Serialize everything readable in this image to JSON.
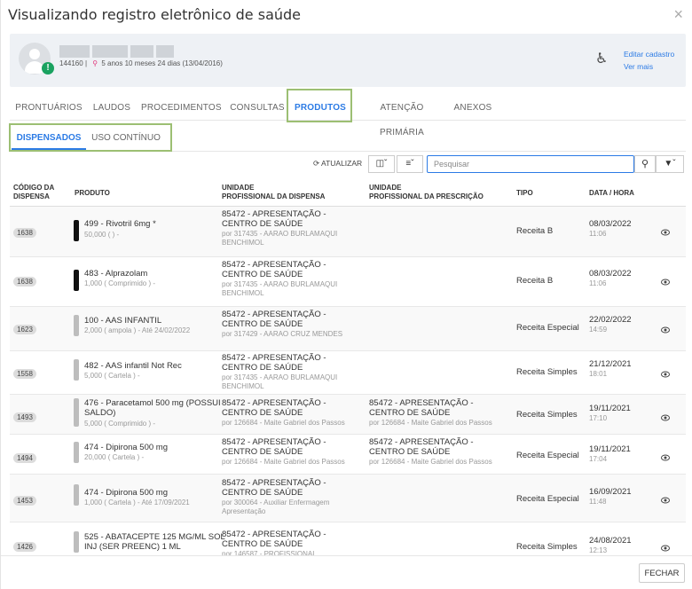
{
  "modal": {
    "title": "Visualizando registro eletrônico de saúde",
    "close_label": "×"
  },
  "patient": {
    "record_number": "144160",
    "separator": "|",
    "age": "5 anos 10 meses 24 dias (13/04/2016)",
    "warning_badge": "!",
    "links": {
      "edit": "Editar cadastro",
      "more": "Ver mais"
    }
  },
  "tabs": [
    {
      "label": "PRONTUÁRIOS"
    },
    {
      "label": "LAUDOS"
    },
    {
      "label": "PROCEDIMENTOS"
    },
    {
      "label": "CONSULTAS"
    },
    {
      "label": "PRODUTOS",
      "active": true
    },
    {
      "label": "ATENÇÃO PRIMÁRIA"
    },
    {
      "label": "ANEXOS"
    }
  ],
  "subtabs": [
    {
      "label": "DISPENSADOS",
      "active": true
    },
    {
      "label": "USO CONTÍNUO"
    }
  ],
  "toolbar": {
    "refresh_label": "ATUALIZAR",
    "search_placeholder": "Pesquisar",
    "columns_icon": "columns-icon",
    "list_icon": "list-icon",
    "search_icon": "search-icon",
    "filter_icon": "filter-icon"
  },
  "table": {
    "headers": {
      "code": [
        "CÓDIGO DA",
        "DISPENSA"
      ],
      "product": "PRODUTO",
      "unit_dispense": [
        "UNIDADE",
        "PROFISSIONAL DA DISPENSA"
      ],
      "unit_prescription": [
        "UNIDADE",
        "PROFISSIONAL DA PRESCRIÇÃO"
      ],
      "type": "TIPO",
      "datetime": "DATA / HORA"
    },
    "rows": [
      {
        "code": "1638",
        "bar_color": "#111111",
        "product": "499 - Rivotril 6mg *",
        "product_detail": "50,000 ( ) -",
        "dispense_unit": "85472 - APRESENTAÇÃO - CENTRO DE SAÚDE",
        "dispense_prof": "por 317435 - AARAO BURLAMAQUI BENCHIMOL",
        "presc_unit": "",
        "presc_prof": "",
        "type": "Receita B",
        "date": "08/03/2022",
        "time": "11:06"
      },
      {
        "code": "1638",
        "bar_color": "#111111",
        "product": "483 - Alprazolam",
        "product_detail": "1,000 ( Comprimido ) -",
        "dispense_unit": "85472 - APRESENTAÇÃO - CENTRO DE SAÚDE",
        "dispense_prof": "por 317435 - AARAO BURLAMAQUI BENCHIMOL",
        "presc_unit": "",
        "presc_prof": "",
        "type": "Receita B",
        "date": "08/03/2022",
        "time": "11:06"
      },
      {
        "code": "1623",
        "bar_color": "#bdbdbd",
        "product": "100 - AAS INFANTIL",
        "product_detail": "2,000 ( ampola ) - Até 24/02/2022",
        "dispense_unit": "85472 - APRESENTAÇÃO - CENTRO DE SAÚDE",
        "dispense_prof": "por 317429 - AARAO CRUZ MENDES",
        "presc_unit": "",
        "presc_prof": "",
        "type": "Receita Especial",
        "date": "22/02/2022",
        "time": "14:59"
      },
      {
        "code": "1558",
        "bar_color": "#bdbdbd",
        "product": "482 - AAS infantil Not Rec",
        "product_detail": "5,000 ( Cartela ) -",
        "dispense_unit": "85472 - APRESENTAÇÃO - CENTRO DE SAÚDE",
        "dispense_prof": "por 317435 - AARAO BURLAMAQUI BENCHIMOL",
        "presc_unit": "",
        "presc_prof": "",
        "type": "Receita Simples",
        "date": "21/12/2021",
        "time": "18:01"
      },
      {
        "code": "1493",
        "bar_color": "#bdbdbd",
        "product": "476 - Paracetamol 500 mg (POSSUI SALDO)",
        "product_detail": "5,000 ( Comprimido ) -",
        "dispense_unit": "85472 - APRESENTAÇÃO - CENTRO DE SAÚDE",
        "dispense_prof": "por 126684 - Maite Gabriel dos Passos",
        "presc_unit": "85472 - APRESENTAÇÃO - CENTRO DE SAÚDE",
        "presc_prof": "por 126684 - Maite Gabriel dos Passos",
        "type": "Receita Simples",
        "date": "19/11/2021",
        "time": "17:10"
      },
      {
        "code": "1494",
        "bar_color": "#bdbdbd",
        "product": "474 - Dipirona 500 mg",
        "product_detail": "20,000 ( Cartela ) -",
        "dispense_unit": "85472 - APRESENTAÇÃO - CENTRO DE SAÚDE",
        "dispense_prof": "por 126684 - Maite Gabriel dos Passos",
        "presc_unit": "85472 - APRESENTAÇÃO - CENTRO DE SAÚDE",
        "presc_prof": "por 126684 - Maite Gabriel dos Passos",
        "type": "Receita Especial",
        "date": "19/11/2021",
        "time": "17:04"
      },
      {
        "code": "1453",
        "bar_color": "#bdbdbd",
        "product": "474 - Dipirona 500 mg",
        "product_detail": "1,000 ( Cartela ) - Até 17/09/2021",
        "dispense_unit": "85472 - APRESENTAÇÃO - CENTRO DE SAÚDE",
        "dispense_prof": "por 300064 - Auxiliar Enfermagem Apresentação",
        "presc_unit": "",
        "presc_prof": "",
        "type": "Receita Especial",
        "date": "16/09/2021",
        "time": "11:48"
      },
      {
        "code": "1426",
        "bar_color": "#bdbdbd",
        "product": "525 - ABATACEPTE 125 MG/ML SOL INJ (SER PREENC) 1 ML",
        "product_detail": "",
        "dispense_unit": "85472 - APRESENTAÇÃO - CENTRO DE SAÚDE",
        "dispense_prof": "por 146587 - PROFISSIONAL",
        "presc_unit": "",
        "presc_prof": "",
        "type": "Receita Simples",
        "date": "24/08/2021",
        "time": "12:13"
      }
    ]
  },
  "footer": {
    "close_button": "FECHAR"
  },
  "colors": {
    "accent": "#2c7be5",
    "highlight": "#9cbf73",
    "warning": "#1aa260"
  }
}
